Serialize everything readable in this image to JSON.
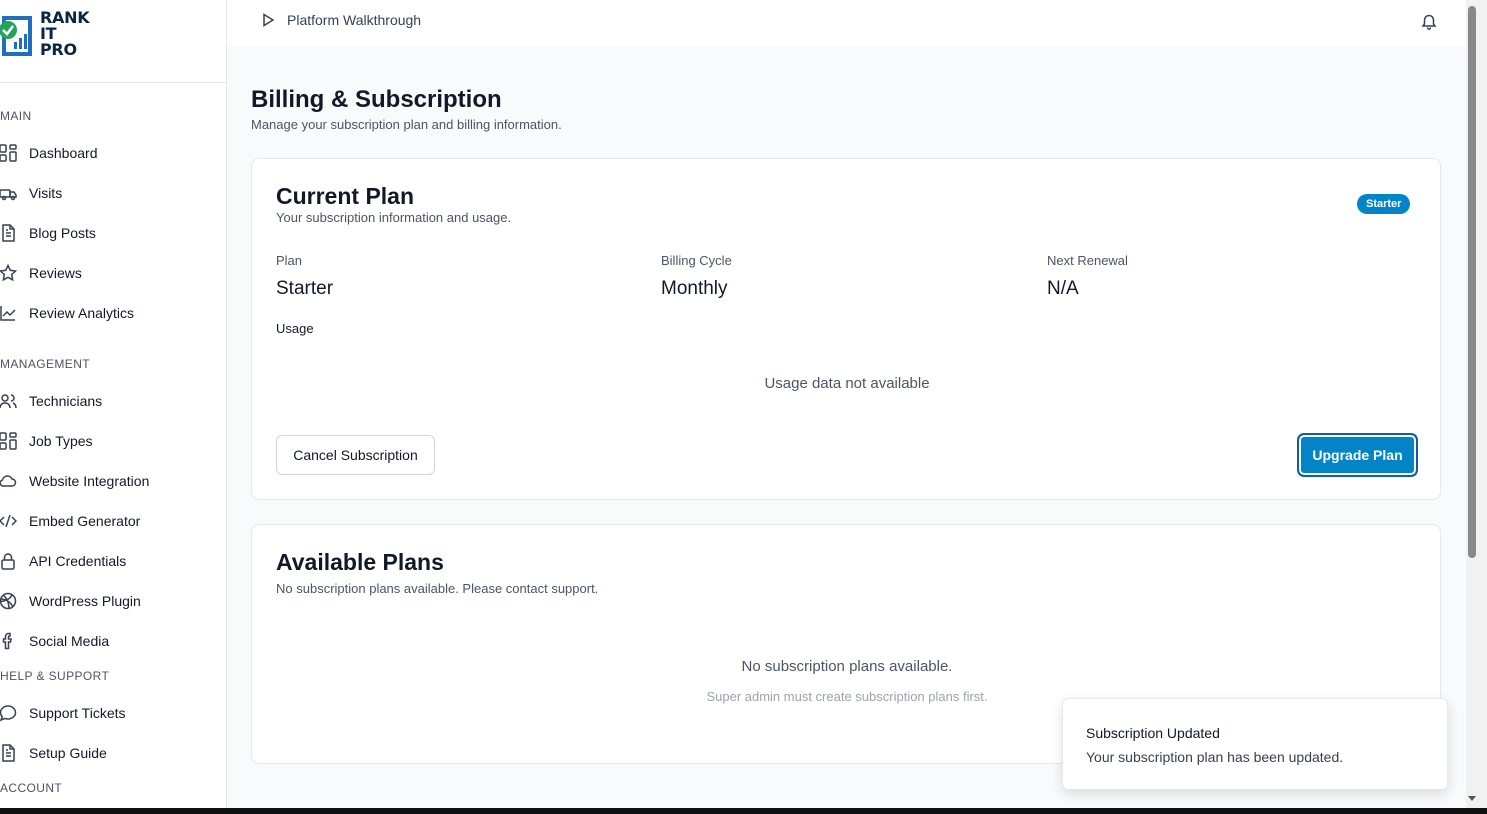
{
  "brand": {
    "name_line1": "RANK",
    "name_line2": "IT",
    "name_line3": "PRO"
  },
  "sidebar": {
    "sections": [
      {
        "label": "MAIN"
      },
      {
        "label": "MANAGEMENT"
      },
      {
        "label": "HELP & SUPPORT"
      },
      {
        "label": "ACCOUNT"
      }
    ],
    "items": [
      {
        "label": "Dashboard",
        "icon": "grid-icon"
      },
      {
        "label": "Visits",
        "icon": "truck-icon"
      },
      {
        "label": "Blog Posts",
        "icon": "document-icon"
      },
      {
        "label": "Reviews",
        "icon": "star-icon"
      },
      {
        "label": "Review Analytics",
        "icon": "line-chart-icon"
      },
      {
        "label": "Technicians",
        "icon": "users-icon"
      },
      {
        "label": "Job Types",
        "icon": "grid-icon"
      },
      {
        "label": "Website Integration",
        "icon": "cloud-icon"
      },
      {
        "label": "Embed Generator",
        "icon": "code-icon"
      },
      {
        "label": "API Credentials",
        "icon": "lock-icon"
      },
      {
        "label": "WordPress Plugin",
        "icon": "globe-icon"
      },
      {
        "label": "Social Media",
        "icon": "facebook-icon"
      },
      {
        "label": "Support Tickets",
        "icon": "chat-icon"
      },
      {
        "label": "Setup Guide",
        "icon": "document-icon"
      }
    ]
  },
  "topbar": {
    "walkthrough_label": "Platform Walkthrough"
  },
  "page": {
    "title": "Billing & Subscription",
    "subtitle": "Manage your subscription plan and billing information."
  },
  "current_plan": {
    "title": "Current Plan",
    "subtitle": "Your subscription information and usage.",
    "badge": "Starter",
    "fields": [
      {
        "label": "Plan",
        "value": "Starter"
      },
      {
        "label": "Billing Cycle",
        "value": "Monthly"
      },
      {
        "label": "Next Renewal",
        "value": "N/A"
      }
    ],
    "usage_label": "Usage",
    "usage_empty": "Usage data not available",
    "cancel_label": "Cancel Subscription",
    "upgrade_label": "Upgrade Plan"
  },
  "available_plans": {
    "title": "Available Plans",
    "subtitle": "No subscription plans available. Please contact support.",
    "empty": "No subscription plans available.",
    "hint": "Super admin must create subscription plans first."
  },
  "toast": {
    "title": "Subscription Updated",
    "message": "Your subscription plan has been updated."
  },
  "colors": {
    "accent": "#0284c7",
    "logo_blue": "#1f6fbf",
    "logo_green": "#22a559"
  }
}
